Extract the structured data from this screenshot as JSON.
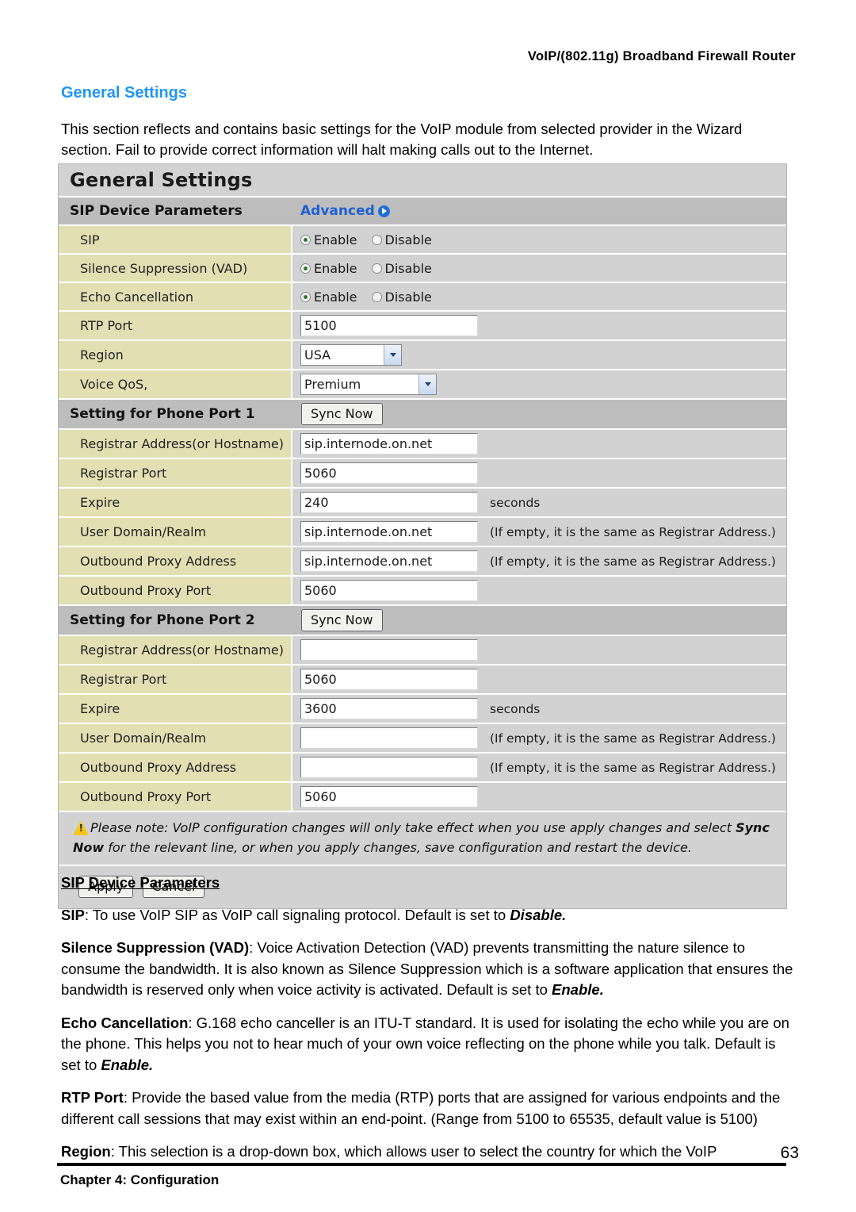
{
  "page": {
    "running_head": "VoIP/(802.11g) Broadband Firewall Router",
    "section_heading": "General Settings",
    "intro": "This section reflects and contains basic settings for the VoIP module from selected provider in the Wizard section. Fail to provide correct information will halt making calls out to the Internet.",
    "number": "63",
    "footer": "Chapter 4: Configuration",
    "heading_color": "#2196f3"
  },
  "ui": {
    "title": "General Settings",
    "sip_device_parameters_label": "SIP Device Parameters",
    "advanced_link": "Advanced",
    "radio_enable": "Enable",
    "radio_disable": "Disable",
    "sync_now": "Sync Now",
    "apply": "Apply",
    "cancel": "Cancel",
    "seconds_suffix": "seconds",
    "empty_hint": "(If empty, it is the same as Registrar Address.)",
    "rows": {
      "sip_label": "SIP",
      "sip_selected": "Enable",
      "vad_label": "Silence Suppression (VAD)",
      "vad_selected": "Enable",
      "echo_label": "Echo Cancellation",
      "echo_selected": "Enable",
      "rtp_port_label": "RTP Port",
      "rtp_port_value": "5100",
      "region_label": "Region",
      "region_value": "USA",
      "voice_qos_label": "Voice QoS,",
      "voice_qos_value": "Premium"
    },
    "phone_port_1": {
      "section_label": "Setting for Phone Port 1",
      "registrar_address_label": "Registrar Address(or Hostname)",
      "registrar_address_value": "sip.internode.on.net",
      "registrar_port_label": "Registrar Port",
      "registrar_port_value": "5060",
      "expire_label": "Expire",
      "expire_value": "240",
      "user_domain_label": "User Domain/Realm",
      "user_domain_value": "sip.internode.on.net",
      "outbound_proxy_address_label": "Outbound Proxy Address",
      "outbound_proxy_address_value": "sip.internode.on.net",
      "outbound_proxy_port_label": "Outbound Proxy Port",
      "outbound_proxy_port_value": "5060"
    },
    "phone_port_2": {
      "section_label": "Setting for Phone Port 2",
      "registrar_address_label": "Registrar Address(or Hostname)",
      "registrar_address_value": "",
      "registrar_port_label": "Registrar Port",
      "registrar_port_value": "5060",
      "expire_label": "Expire",
      "expire_value": "3600",
      "user_domain_label": "User Domain/Realm",
      "user_domain_value": "",
      "outbound_proxy_address_label": "Outbound Proxy Address",
      "outbound_proxy_address_value": "",
      "outbound_proxy_port_label": "Outbound Proxy Port",
      "outbound_proxy_port_value": "5060"
    },
    "note": {
      "part1": "Please note: VoIP configuration changes will only take effect when you use apply changes and select ",
      "emphasis": "Sync Now",
      "part2": " for the relevant line, or when you apply changes, save configuration and restart the device."
    }
  },
  "body": {
    "subhead": "SIP Device Parameters",
    "p_sip": {
      "term": "SIP",
      "text": ": To use VoIP SIP as VoIP call signaling protocol. Default is set to ",
      "emphasis": "Disable."
    },
    "p_vad": {
      "term": "Silence Suppression (VAD)",
      "text": ": Voice Activation Detection (VAD) prevents transmitting the nature silence to consume the bandwidth. It is also known as Silence Suppression which is a software application that ensures the bandwidth is reserved only when voice activity is activated.   Default is set to ",
      "emphasis": "Enable."
    },
    "p_echo": {
      "term": "Echo Cancellation",
      "text": ": G.168 echo canceller is an ITU-T standard.   It is used for isolating the echo while you are on the phone. This helps you not to hear much of your own voice reflecting on the phone while you talk. Default is set to ",
      "emphasis": "Enable."
    },
    "p_rtp": {
      "term": "RTP Port",
      "text": ": Provide the based value from the media (RTP) ports that are assigned for various endpoints and the different call sessions that may exist within an end-point. (Range from 5100 to 65535, default value is 5100)",
      "emphasis": ""
    },
    "p_region": {
      "term": "Region",
      "text": ": This selection is a drop-down box, which allows user to select the country for which the VoIP",
      "emphasis": ""
    }
  }
}
